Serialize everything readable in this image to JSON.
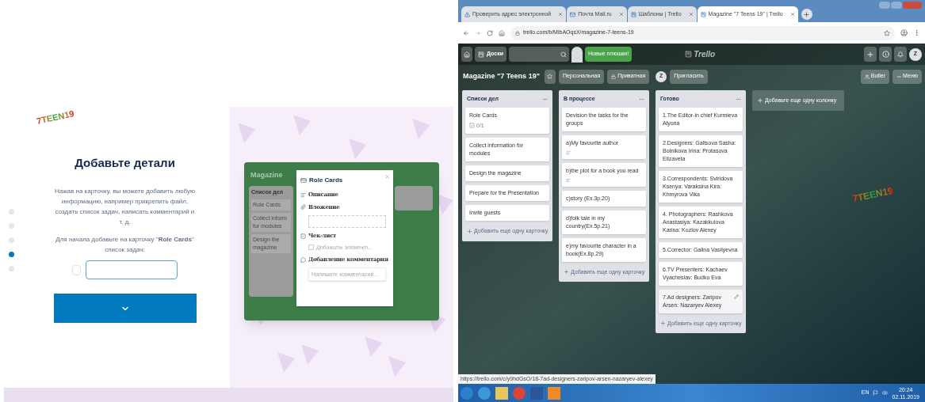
{
  "logo_marks": [
    {
      "text": "7TEEN19"
    },
    {
      "text": "7TEEN19"
    }
  ],
  "onboarding": {
    "steps": [
      {
        "selected": false
      },
      {
        "selected": false
      },
      {
        "selected": false
      },
      {
        "selected": true
      },
      {
        "selected": false
      }
    ],
    "heading": "Добавьте детали",
    "paragraphs": [
      "Нажав на карточку, вы можете добавить любую информацию, например прикрепить файл, создать список задач, написать комментарий и т. д.",
      "Для начала добавьте на карточку \"**Role Cards**\" список задач:"
    ],
    "task": {
      "checked": false
    }
  },
  "preview": {
    "board_title": "Magazine",
    "list_title": "Список дел",
    "cards": [
      "Role Cards",
      "Collect inform for modules",
      "Design the magazine"
    ],
    "modal": {
      "title": "Role Cards",
      "sections": [
        {
          "kind": "description",
          "label": "Описание"
        },
        {
          "kind": "attachment",
          "label": "Вложение"
        },
        {
          "kind": "checklist",
          "label": "Чек-лист",
          "item_placeholder": "Добавить элемент...",
          "item_checked": false
        },
        {
          "kind": "comment",
          "label": "Добавление комментария",
          "placeholder": "Напишите комментарий..."
        }
      ]
    }
  },
  "browser": {
    "tabs": [
      {
        "title": "Проверить адрес электронной",
        "kind": "alert",
        "selected": false
      },
      {
        "title": "Почта Mail.ru",
        "kind": "mail",
        "selected": false
      },
      {
        "title": "Шаблоны | Trello",
        "kind": "trello",
        "selected": false
      },
      {
        "title": "Magazine \"7 Teens 19\" | Trello",
        "kind": "trello",
        "selected": true
      }
    ],
    "address": "trello.com/b/MibAOqsX/magazine-7-teens-19",
    "status_url": "https://trello.com/c/y9hdGsO/18-7ad-designers-zaripov-arsen-nazaryev-alexey"
  },
  "trello": {
    "boards_button": "Доски",
    "promo": "Новые плюшки!",
    "logo": "Trello",
    "avatar": "Z",
    "board": {
      "title": "Magazine \"7 Teens 19\"",
      "team": "Персональная",
      "visibility": "Приватная",
      "member": "Z",
      "invite": "Пригласить",
      "butler": "Butler",
      "menu": "Меню"
    },
    "lists": [
      {
        "title": "Список дел",
        "cards": [
          {
            "text": "Role Cards",
            "badge": {
              "kind": "checklist",
              "text": "0/1"
            },
            "hovered": false
          },
          {
            "text": "Collect information for modules",
            "hovered": false
          },
          {
            "text": "Design the magazine",
            "hovered": false
          },
          {
            "text": "Prepare for the Presentation",
            "hovered": false
          },
          {
            "text": "Invite guests",
            "hovered": false
          }
        ],
        "add_card": "Добавить еще одну карточку"
      },
      {
        "title": "В процессе",
        "cards": [
          {
            "text": "Devision the tasks for the groups",
            "hovered": false
          },
          {
            "text": "a)My favourite author",
            "badge": {
              "kind": "description"
            },
            "hovered": false
          },
          {
            "text": "b)the plot for a book you read",
            "badge": {
              "kind": "description"
            },
            "hovered": false
          },
          {
            "text": "c)story (Ex.3p.20)",
            "hovered": false
          },
          {
            "text": "d)folk tale in my country(Ex.5p.21)",
            "hovered": false
          },
          {
            "text": "e)my favourite character in a book(Ex.8p.29)",
            "hovered": false
          }
        ],
        "add_card": "Добавить еще одну карточку"
      },
      {
        "title": "Готово",
        "cards": [
          {
            "text": "1.The Editor-in chief Kurmieva Alyona",
            "hovered": false
          },
          {
            "text": "2.Designers: Galtsova Sasha: Botnikova Irina: Protasova Elizaveta",
            "hovered": false
          },
          {
            "text": "3.Correspondents: Sviridova Ksenya: Varaksina Kira: Khmyrova Vika",
            "hovered": false
          },
          {
            "text": "4. Photographers: Rashkova Anastasiya: Kazakkulova Karina: Kozlov Alexey",
            "hovered": false
          },
          {
            "text": "5.Corrector: Galina Vasilyevna",
            "hovered": false
          },
          {
            "text": "6.TV Presenters: Kachaev Vyacheslav: Budko Eva",
            "hovered": false
          },
          {
            "text": "7.Ad designers: Zaripov Arsen: Nazaryev Alexey",
            "hovered": true
          }
        ],
        "add_card": "Добавить еще одну карточку"
      }
    ],
    "add_list": "Добавьте еще одну колонку"
  },
  "taskbar": {
    "apps": [
      {
        "kind": "start"
      },
      {
        "kind": "ie"
      },
      {
        "kind": "files"
      },
      {
        "kind": "chrome"
      },
      {
        "kind": "word"
      },
      {
        "kind": "app"
      }
    ],
    "language": "EN",
    "time": "20:24",
    "date": "02.11.2019"
  }
}
